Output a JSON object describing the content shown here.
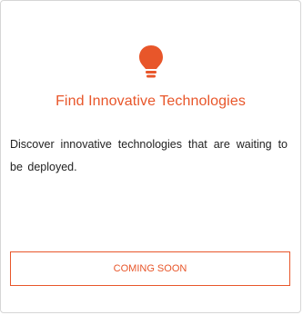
{
  "card": {
    "icon": "lightbulb-icon",
    "title": "Find Innovative Technologies",
    "description": "Discover innovative technologies that are waiting to be deployed.",
    "button_label": "COMING SOON"
  },
  "colors": {
    "accent": "#e8562a",
    "text": "#222222",
    "border": "#d6d6d6"
  }
}
